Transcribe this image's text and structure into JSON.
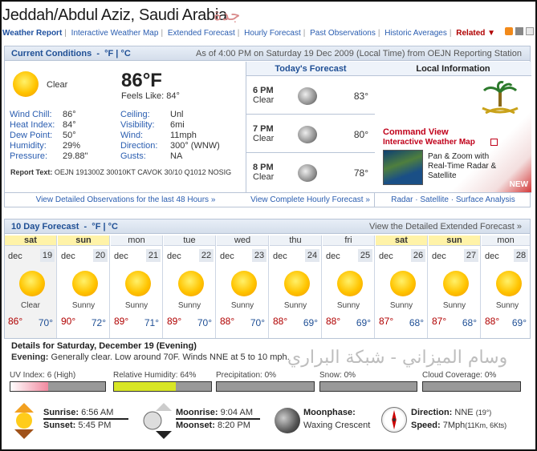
{
  "header": {
    "title": "Jeddah/Abdul Aziz, Saudi Arabia",
    "title_ar": "جدة"
  },
  "nav": {
    "items": [
      "Weather Report",
      "Interactive Weather Map",
      "Extended Forecast",
      "Hourly Forecast",
      "Past Observations",
      "Historic Averages"
    ],
    "related": "Related ▼"
  },
  "current": {
    "heading": "Current Conditions",
    "unit_f": "°F",
    "unit_c": "°C",
    "asof": "As of 4:00 PM on Saturday 19 Dec 2009 (Local Time) from OEJN Reporting Station",
    "condition": "Clear",
    "temp": "86°F",
    "feels": "Feels Like: 84°",
    "left_stats": [
      {
        "k": "Wind Chill:",
        "v": "86°"
      },
      {
        "k": "Heat Index:",
        "v": "84°"
      },
      {
        "k": "Dew Point:",
        "v": "50°"
      },
      {
        "k": "Humidity:",
        "v": "29%"
      },
      {
        "k": "Pressure:",
        "v": "29.88\""
      }
    ],
    "right_stats": [
      {
        "k": "Ceiling:",
        "v": "Unl"
      },
      {
        "k": "Visibility:",
        "v": "6mi"
      },
      {
        "k": "Wind:",
        "v": "11mph"
      },
      {
        "k": "Direction:",
        "v": "300° (WNW)"
      },
      {
        "k": "Gusts:",
        "v": "NA"
      }
    ],
    "report_label": "Report Text:",
    "report_text": "OEJN 191300Z 30010KT CAVOK 30/10 Q1012 NOSIG",
    "link": "View Detailed Observations for the last 48 Hours »"
  },
  "today": {
    "heading": "Today's Forecast",
    "hours": [
      {
        "time": "6 PM",
        "cond": "Clear",
        "temp": "83°"
      },
      {
        "time": "7 PM",
        "cond": "Clear",
        "temp": "80°"
      },
      {
        "time": "8 PM",
        "cond": "Clear",
        "temp": "78°"
      }
    ],
    "link": "View Complete Hourly Forecast »"
  },
  "local": {
    "heading": "Local Information",
    "cv_title": "Command View",
    "cv_sub": "Interactive Weather Map",
    "cv_text": "Pan & Zoom with Real-Time Radar & Satellite",
    "badge": "NEW",
    "link": "Radar · Satellite · Surface Analysis"
  },
  "ten": {
    "heading": "10 Day Forecast",
    "unit_f": "°F",
    "unit_c": "°C",
    "link": "View the Detailed Extended Forecast »",
    "days": [
      {
        "dn": "sat",
        "mo": "dec",
        "dd": "19",
        "cond": "Clear",
        "hi": "86°",
        "lo": "70°",
        "we": true
      },
      {
        "dn": "sun",
        "mo": "dec",
        "dd": "20",
        "cond": "Sunny",
        "hi": "90°",
        "lo": "72°",
        "we": true
      },
      {
        "dn": "mon",
        "mo": "dec",
        "dd": "21",
        "cond": "Sunny",
        "hi": "89°",
        "lo": "71°",
        "we": false
      },
      {
        "dn": "tue",
        "mo": "dec",
        "dd": "22",
        "cond": "Sunny",
        "hi": "89°",
        "lo": "70°",
        "we": false
      },
      {
        "dn": "wed",
        "mo": "dec",
        "dd": "23",
        "cond": "Sunny",
        "hi": "88°",
        "lo": "70°",
        "we": false
      },
      {
        "dn": "thu",
        "mo": "dec",
        "dd": "24",
        "cond": "Sunny",
        "hi": "88°",
        "lo": "69°",
        "we": false
      },
      {
        "dn": "fri",
        "mo": "dec",
        "dd": "25",
        "cond": "Sunny",
        "hi": "88°",
        "lo": "69°",
        "we": false
      },
      {
        "dn": "sat",
        "mo": "dec",
        "dd": "26",
        "cond": "Sunny",
        "hi": "87°",
        "lo": "68°",
        "we": true
      },
      {
        "dn": "sun",
        "mo": "dec",
        "dd": "27",
        "cond": "Sunny",
        "hi": "87°",
        "lo": "68°",
        "we": true
      },
      {
        "dn": "mon",
        "mo": "dec",
        "dd": "28",
        "cond": "Sunny",
        "hi": "88°",
        "lo": "69°",
        "we": false
      }
    ]
  },
  "details": {
    "heading": "Details for Saturday, December 19 (Evening)",
    "label": "Evening:",
    "text": "Generally clear. Low around 70F. Winds NNE at 5 to 10 mph.",
    "watermark": "وسام الميزاني - شبكة البراري"
  },
  "meters": [
    {
      "label": "UV Index: 6 (High)",
      "pct": 0.55,
      "color": "#f2b8c2"
    },
    {
      "label": "Relative Humidity: 64%",
      "pct": 0.64,
      "color": "#d8e626"
    },
    {
      "label": "Precipitation: 0%",
      "pct": 0,
      "color": "#999"
    },
    {
      "label": "Snow: 0%",
      "pct": 0,
      "color": "#999"
    },
    {
      "label": "Cloud Coverage: 0%",
      "pct": 0,
      "color": "#999"
    }
  ],
  "astro": {
    "sunrise_l": "Sunrise:",
    "sunrise": "6:56 AM",
    "sunset_l": "Sunset:",
    "sunset": "5:45 PM",
    "moonrise_l": "Moonrise:",
    "moonrise": "9:04 AM",
    "moonset_l": "Moonset:",
    "moonset": "8:20 PM",
    "phase_l": "Moonphase:",
    "phase": "Waxing Crescent",
    "dir_l": "Direction:",
    "dir": "NNE",
    "dir_deg": "(19°)",
    "speed_l": "Speed:",
    "speed": "7Mph",
    "speed_alt": "(11Km, 6Kts)"
  }
}
